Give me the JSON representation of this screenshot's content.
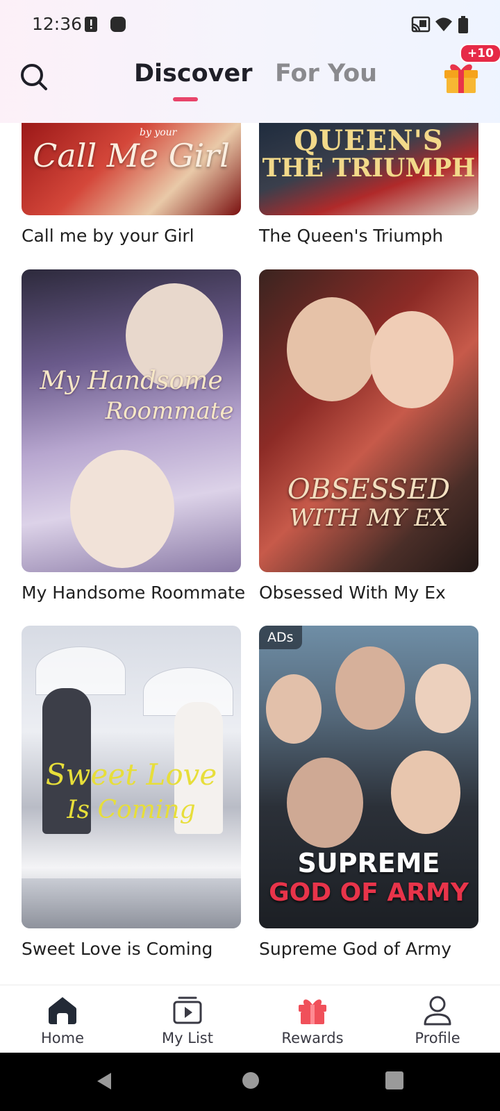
{
  "status_bar": {
    "time": "12:36",
    "icons": [
      "alert-icon",
      "square-icon",
      "cast-icon",
      "wifi-icon",
      "battery-icon"
    ]
  },
  "header": {
    "tabs": [
      {
        "label": "Discover",
        "active": true
      },
      {
        "label": "For You",
        "active": false
      }
    ],
    "gift_badge": "+10",
    "accent_color": "#e8446a"
  },
  "dramas": [
    {
      "title": "Call me by your Girl",
      "poster_text": "Call Me Girl",
      "poster_sub": "by your"
    },
    {
      "title": "The Queen's Triumph",
      "poster_text": "QUEEN'S",
      "poster_sub": "THE TRIUMPH"
    },
    {
      "title": "My Handsome Roommate",
      "poster_text": "My Handsome",
      "poster_sub": "Roommate"
    },
    {
      "title": "Obsessed With My Ex",
      "poster_text": "OBSESSED",
      "poster_sub": "WITH MY EX"
    },
    {
      "title": "Sweet Love is Coming",
      "poster_text": "Sweet Love",
      "poster_sub": "Is Coming"
    },
    {
      "title": "Supreme God of Army",
      "poster_text": "SUPREME",
      "poster_sub": "GOD OF ARMY",
      "badge": "ADs"
    }
  ],
  "bottom_nav": [
    {
      "label": "Home",
      "icon": "home-icon",
      "active": true
    },
    {
      "label": "My List",
      "icon": "play-list-icon",
      "active": false
    },
    {
      "label": "Rewards",
      "icon": "gift-icon",
      "active": false
    },
    {
      "label": "Profile",
      "icon": "profile-icon",
      "active": false
    }
  ]
}
